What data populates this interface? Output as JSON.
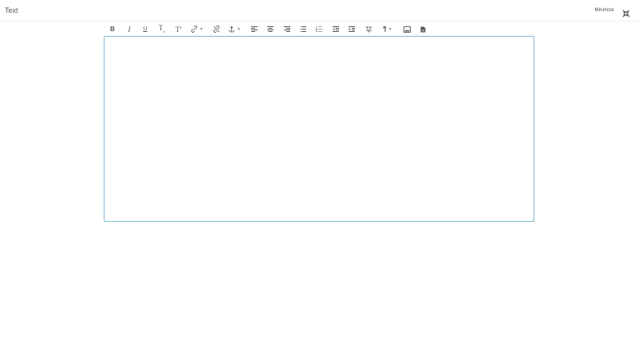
{
  "header": {
    "title": "Text",
    "minimize_label": "Minimize"
  },
  "toolbar": {
    "buttons": [
      {
        "name": "bold",
        "glyph": "B"
      },
      {
        "name": "italic",
        "glyph": "I"
      },
      {
        "name": "underline",
        "glyph": "U"
      },
      {
        "name": "subscript",
        "glyph": "T"
      },
      {
        "name": "superscript",
        "glyph": "T"
      }
    ]
  },
  "editor": {
    "value": ""
  },
  "colors": {
    "accent_border": "#84b8d8",
    "icon": "#555555"
  }
}
